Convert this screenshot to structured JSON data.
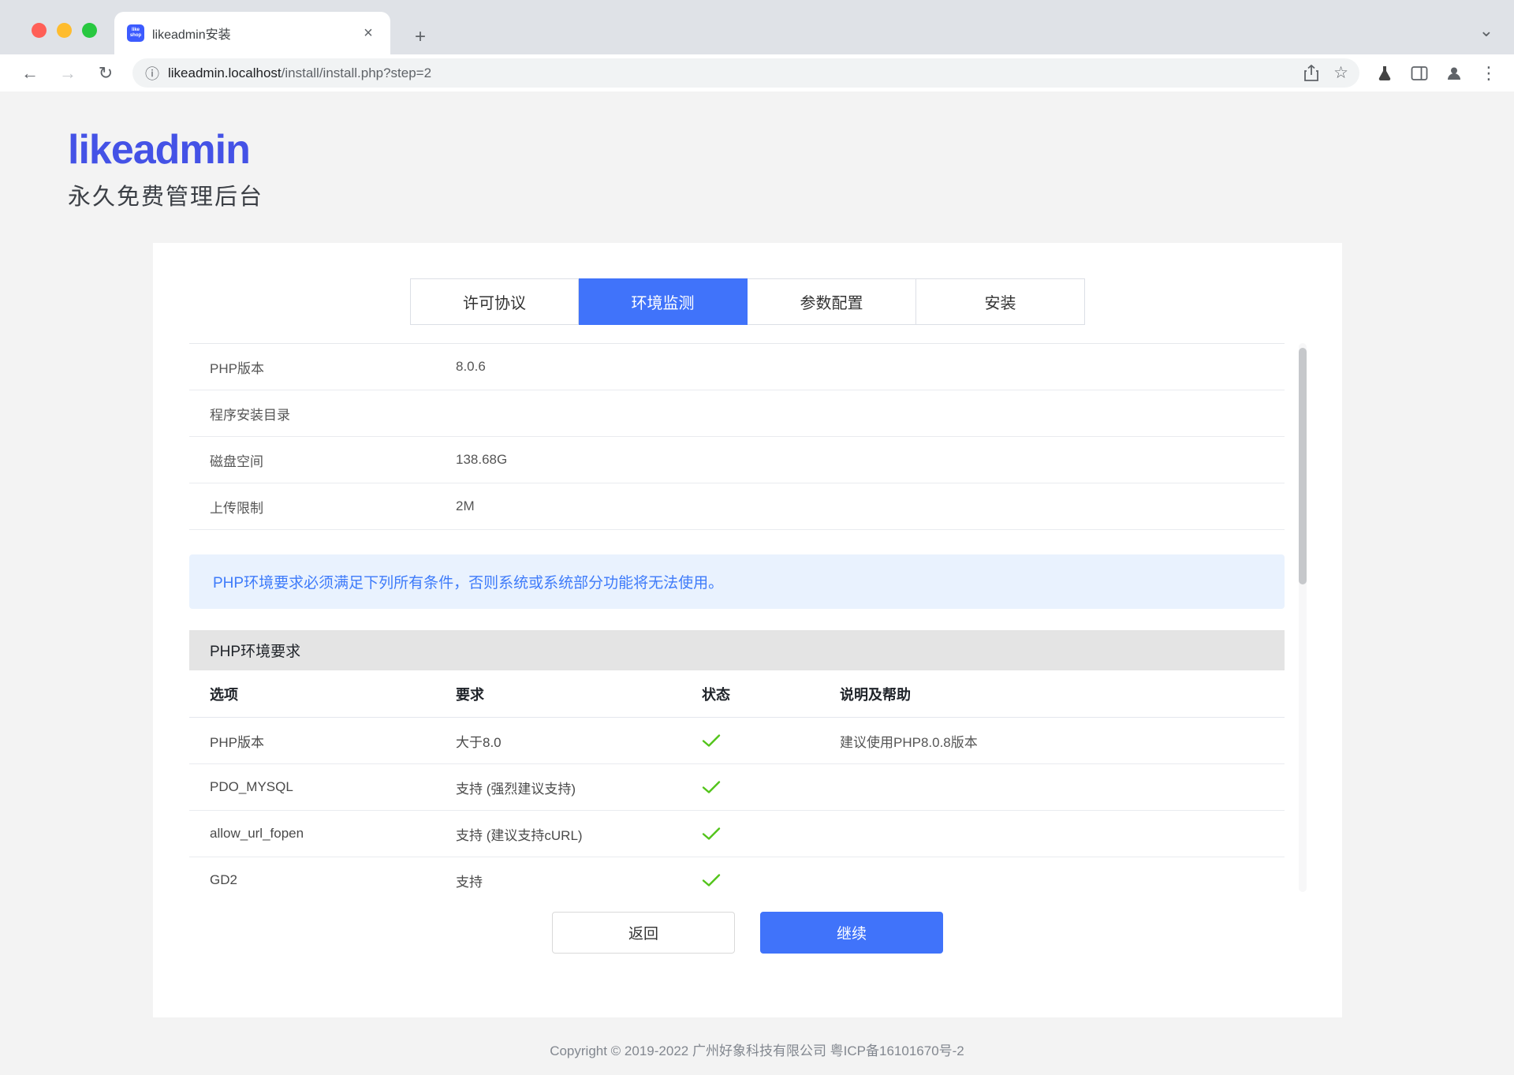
{
  "browser": {
    "tab": {
      "title": "likeadmin安装",
      "favicon_text": "like shop"
    },
    "url": {
      "host": "likeadmin.localhost",
      "path": "/install/install.php?step=2"
    }
  },
  "icons": {
    "close": "×",
    "new_tab": "+",
    "window_chevron": "⌄",
    "back": "←",
    "forward": "→",
    "reload": "↻",
    "info": "ⓘ",
    "star": "☆",
    "menu_dots": "⋮"
  },
  "brand": {
    "logo": "likeadmin",
    "tagline": "永久免费管理后台"
  },
  "steps": [
    {
      "label": "许可协议",
      "active": false
    },
    {
      "label": "环境监测",
      "active": true
    },
    {
      "label": "参数配置",
      "active": false
    },
    {
      "label": "安装",
      "active": false
    }
  ],
  "env_info": {
    "rows": [
      {
        "label": "PHP版本",
        "value": "8.0.6"
      },
      {
        "label": "程序安装目录",
        "value": ""
      },
      {
        "label": "磁盘空间",
        "value": "138.68G"
      },
      {
        "label": "上传限制",
        "value": "2M"
      }
    ]
  },
  "notice": {
    "text": "PHP环境要求必须满足下列所有条件，否则系统或系统部分功能将无法使用。"
  },
  "requirements": {
    "section_title": "PHP环境要求",
    "headers": {
      "option": "选项",
      "requirement": "要求",
      "status": "状态",
      "help": "说明及帮助"
    },
    "rows": [
      {
        "option": "PHP版本",
        "requirement": "大于8.0",
        "status": "pass",
        "help": "建议使用PHP8.0.8版本"
      },
      {
        "option": "PDO_MYSQL",
        "requirement": "支持 (强烈建议支持)",
        "status": "pass",
        "help": ""
      },
      {
        "option": "allow_url_fopen",
        "requirement": "支持 (建议支持cURL)",
        "status": "pass",
        "help": ""
      },
      {
        "option": "GD2",
        "requirement": "支持",
        "status": "pass",
        "help": ""
      }
    ]
  },
  "actions": {
    "back": "返回",
    "continue": "继续"
  },
  "footer": {
    "copyright": "Copyright © 2019-2022 广州好象科技有限公司 粤ICP备16101670号-2"
  },
  "colors": {
    "accent": "#4073fa",
    "success": "#52c41a",
    "notice_bg": "#e9f2fe",
    "notice_text": "#3e7bfa",
    "brand": "#4452e6"
  }
}
